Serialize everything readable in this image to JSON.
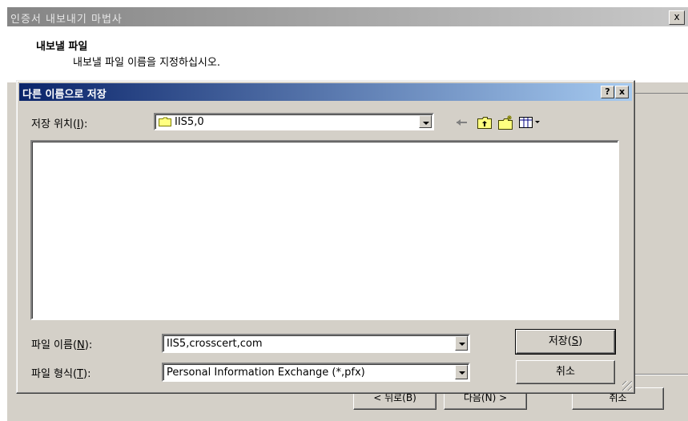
{
  "wizard": {
    "title": "인증서 내보내기 마법사",
    "close_label": "x",
    "heading": "내보낼 파일",
    "subheading": "내보낼 파일 이름을 지정하십시오.",
    "back_label": "< 뒤로(B)",
    "next_label": "다음(N) >",
    "cancel_label": "취소"
  },
  "dialog": {
    "title": "다른 이름으로 저장",
    "help_label": "?",
    "close_label": "x",
    "save_in_label_pre": "저장 위치(",
    "save_in_label_key": "I",
    "save_in_label_post": "):",
    "save_in_value": "IIS5,0",
    "toolbar": {
      "back_icon": "back-arrow-icon",
      "up_icon": "up-folder-icon",
      "new_folder_icon": "new-folder-icon",
      "view_menu_icon": "view-menu-icon"
    },
    "filename_label_pre": "파일 이름(",
    "filename_label_key": "N",
    "filename_label_post": "):",
    "filename_value": "IIS5,crosscert,com",
    "filetype_label_pre": "파일 형식(",
    "filetype_label_key": "T",
    "filetype_label_post": "):",
    "filetype_value": "Personal Information Exchange (*,pfx)",
    "save_button_pre": "저장(",
    "save_button_key": "S",
    "save_button_post": ")",
    "cancel_button": "취소"
  },
  "colors": {
    "active_title_start": "#0a246a",
    "active_title_end": "#a6caf0",
    "face": "#d4d0c8"
  }
}
